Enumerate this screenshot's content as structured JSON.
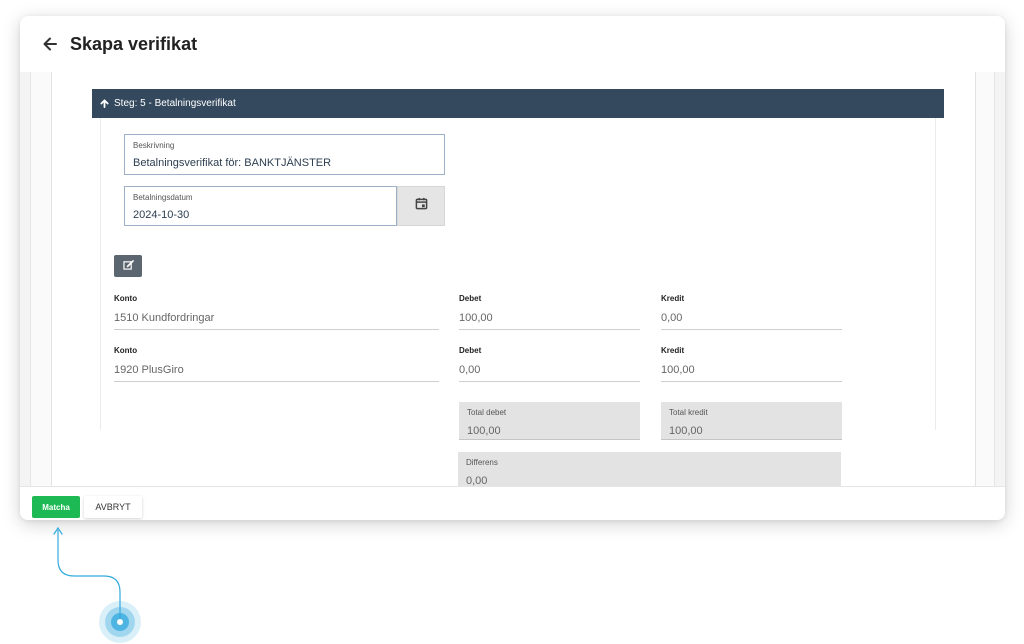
{
  "header": {
    "title": "Skapa verifikat"
  },
  "step": {
    "label": "Steg: 5 - Betalningsverifikat"
  },
  "form": {
    "description": {
      "label": "Beskrivning",
      "value": "Betalningsverifikat för: BANKTJÄNSTER"
    },
    "payment_date": {
      "label": "Betalningsdatum",
      "value": "2024-10-30"
    }
  },
  "rows": [
    {
      "konto_label": "Konto",
      "konto": "1510 Kundfordringar",
      "debet_label": "Debet",
      "debet": "100,00",
      "kredit_label": "Kredit",
      "kredit": "0,00"
    },
    {
      "konto_label": "Konto",
      "konto": "1920 PlusGiro",
      "debet_label": "Debet",
      "debet": "0,00",
      "kredit_label": "Kredit",
      "kredit": "100,00"
    }
  ],
  "totals": {
    "total_debet_label": "Total debet",
    "total_debet": "100,00",
    "total_kredit_label": "Total kredit",
    "total_kredit": "100,00",
    "differens_label": "Differens",
    "differens": "0,00"
  },
  "footer": {
    "match_label": "Matcha",
    "cancel_label": "AVBRYT"
  },
  "icons": {
    "back": "arrow-left-icon",
    "step": "arrow-up-icon",
    "calendar": "calendar-icon",
    "edit": "edit-icon"
  },
  "colors": {
    "step_header": "#34495e",
    "match_button": "#1db954",
    "pointer": "#33aadd"
  }
}
